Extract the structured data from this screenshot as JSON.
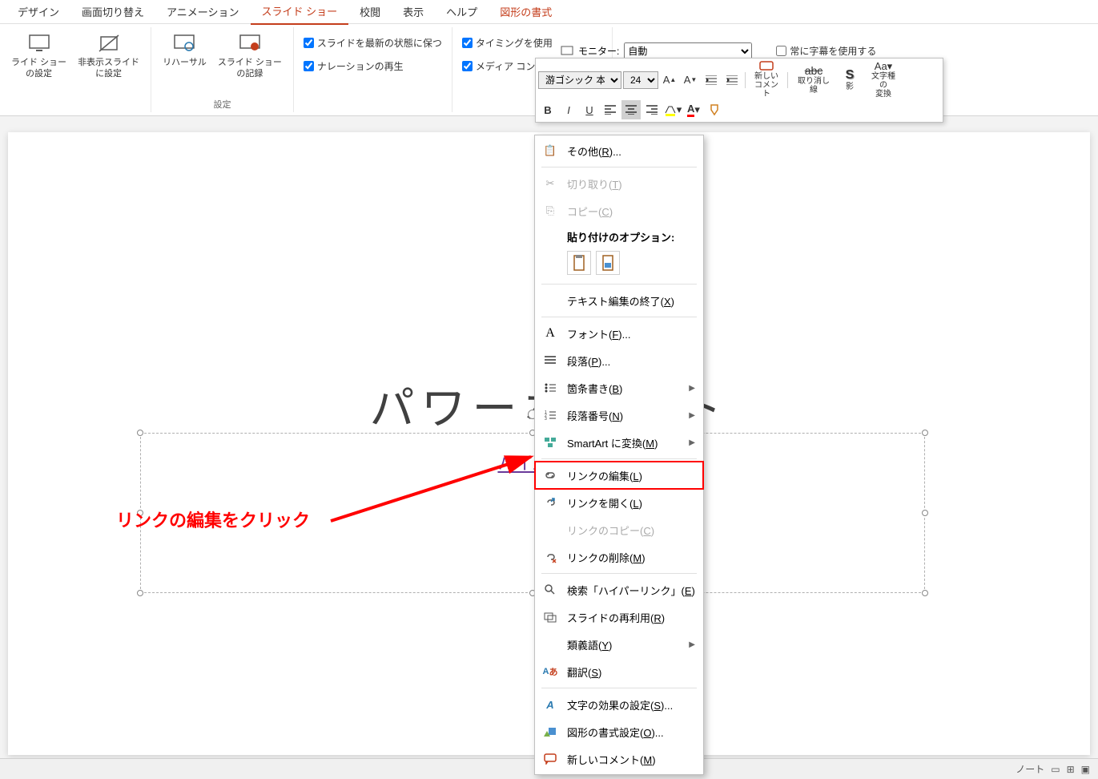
{
  "tabs": {
    "design": "デザイン",
    "transitions": "画面切り替え",
    "animations": "アニメーション",
    "slideshow": "スライド ショー",
    "review": "校閲",
    "view": "表示",
    "help": "ヘルプ",
    "format": "図形の書式"
  },
  "ribbon": {
    "slideshow_setup": "ライド ショー\nの設定",
    "hide_slide": "非表示スライド\nに設定",
    "rehearse": "リハーサル",
    "record": "スライド ショー\nの記録",
    "group_setup": "設定",
    "chk_keep_updated": "スライドを最新の状態に保つ",
    "chk_narration": "ナレーションの再生",
    "chk_timing": "タイミングを使用",
    "chk_media": "メディア コントロールの表示",
    "monitor_label": "モニター:",
    "monitor_value": "自動",
    "chk_subtitle": "常に字幕を使用する"
  },
  "mini": {
    "font": "游ゴシック 本文",
    "size": "24",
    "new_comment": "新しい\nコメント",
    "strikethrough": "取り消し線",
    "shadow": "影",
    "char_convert": "文字種の\n変換"
  },
  "slide": {
    "title": "パワーホ　　ト",
    "subtitle": "ハイパー"
  },
  "annotation": "リンクの編集をクリック",
  "context": {
    "other": "その他(R)...",
    "cut": "切り取り(T)",
    "copy": "コピー(C)",
    "paste_header": "貼り付けのオプション:",
    "exit_text": "テキスト編集の終了(X)",
    "font": "フォント(F)...",
    "paragraph": "段落(P)...",
    "bullets": "箇条書き(B)",
    "numbering": "段落番号(N)",
    "smartart": "SmartArt に変換(M)",
    "edit_link": "リンクの編集(L)",
    "open_link": "リンクを開く(L)",
    "copy_link": "リンクのコピー(C)",
    "delete_link": "リンクの削除(M)",
    "search": "検索「ハイパーリンク」(E)",
    "reuse": "スライドの再利用(R)",
    "synonyms": "類義語(Y)",
    "translate": "翻訳(S)",
    "text_effects": "文字の効果の設定(S)...",
    "shape_format": "図形の書式設定(O)...",
    "new_comment": "新しいコメント(M)"
  },
  "status": {
    "left": "",
    "notes": "ノート"
  }
}
